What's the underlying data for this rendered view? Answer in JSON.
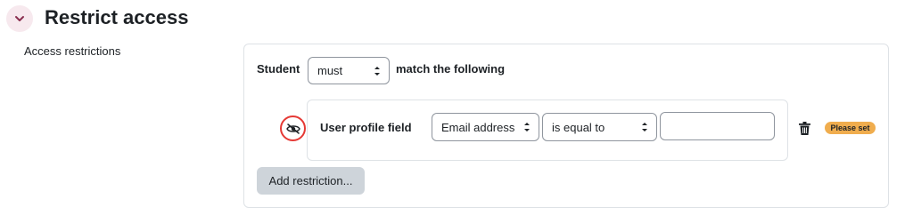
{
  "section": {
    "title": "Restrict access"
  },
  "field_label": "Access restrictions",
  "restriction": {
    "subject": "Student",
    "requirement": "must",
    "match_text": "match the following",
    "condition": {
      "type_label": "User profile field",
      "field": "Email address",
      "operator": "is equal to",
      "value": "",
      "status_badge": "Please set"
    },
    "add_button": "Add restriction..."
  },
  "icons": {
    "toggle": "chevron-down-icon",
    "eye": "eye-slash-icon",
    "delete": "trash-icon"
  },
  "colors": {
    "toggle_bg": "#f7e9ee",
    "accent": "#8a2f4f",
    "highlight_ring": "#e53935",
    "badge_bg": "#f0ad4e",
    "button_bg": "#ced4da"
  }
}
